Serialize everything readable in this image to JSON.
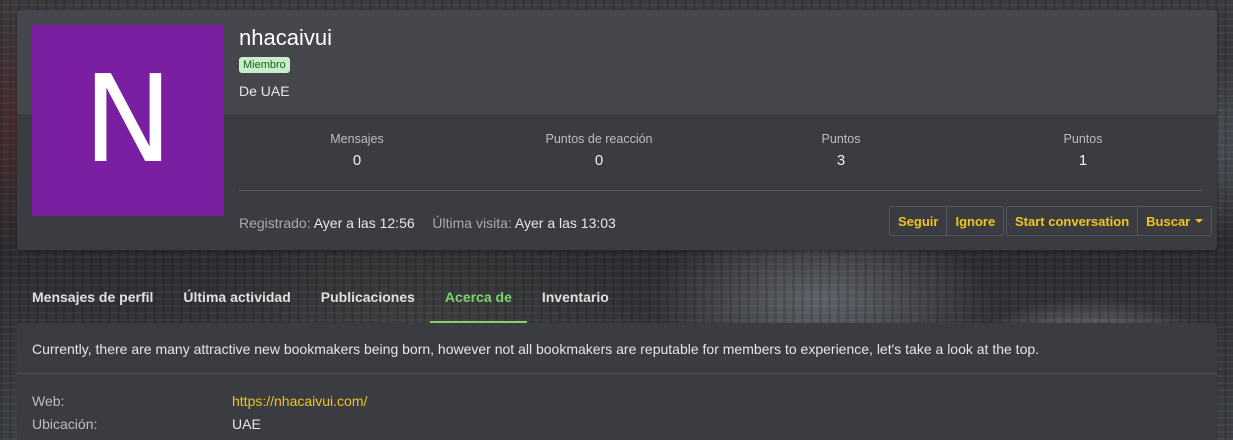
{
  "profile": {
    "avatar_letter": "N",
    "avatar_color": "#7b1fa2",
    "username": "nhacaivui",
    "role_badge": "Miembro",
    "location_line": "De UAE"
  },
  "stats": [
    {
      "label": "Mensajes",
      "value": "0"
    },
    {
      "label": "Puntos de reacción",
      "value": "0"
    },
    {
      "label": "Puntos",
      "value": "3"
    },
    {
      "label": "Puntos",
      "value": "1"
    }
  ],
  "meta": {
    "registered_label": "Registrado:",
    "registered_value": "Ayer a las 12:56",
    "last_visit_label": "Última visita:",
    "last_visit_value": "Ayer a las 13:03"
  },
  "actions": {
    "follow": "Seguir",
    "ignore": "Ignore",
    "start_conversation": "Start conversation",
    "search": "Buscar"
  },
  "tabs": [
    {
      "label": "Mensajes de perfil",
      "active": false
    },
    {
      "label": "Última actividad",
      "active": false
    },
    {
      "label": "Publicaciones",
      "active": false
    },
    {
      "label": "Acerca de",
      "active": true
    },
    {
      "label": "Inventario",
      "active": false
    }
  ],
  "about": {
    "bio": "Currently, there are many attractive new bookmakers being born, however not all bookmakers are reputable for members to experience, let's take a look at the top.",
    "website_label": "Web:",
    "website_value": "https://nhacaivui.com/",
    "location_label": "Ubicación:",
    "location_value": "UAE"
  },
  "colors": {
    "accent": "#f0c419",
    "active_tab": "#7fd36a",
    "badge_bg": "#c8f0c8"
  }
}
